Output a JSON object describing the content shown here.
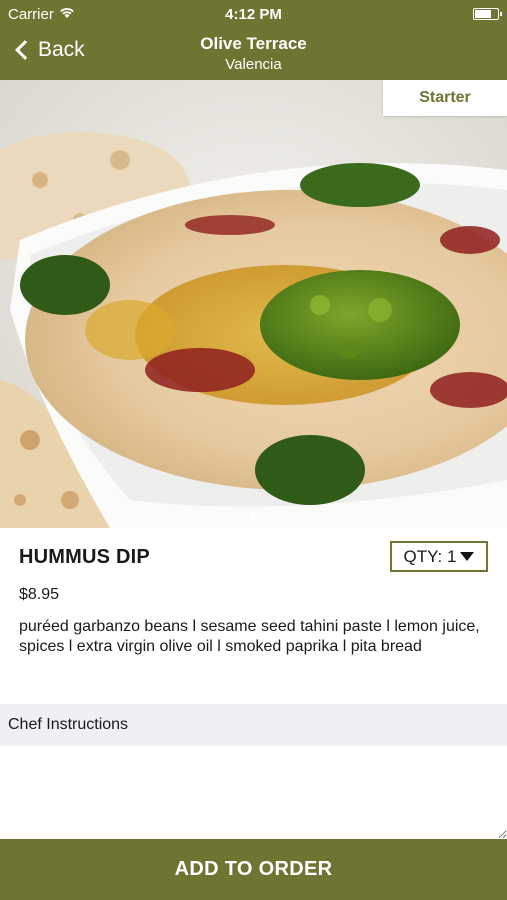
{
  "status_bar": {
    "carrier": "Carrier",
    "time": "4:12 PM",
    "wifi_icon": "wifi-icon",
    "battery_icon": "battery-icon"
  },
  "nav": {
    "back_label": "Back",
    "title": "Olive Terrace",
    "subtitle": "Valencia",
    "back_icon": "chevron-left-icon"
  },
  "hero": {
    "category": "Starter",
    "image_subject": "hummus-dish-photo"
  },
  "item": {
    "name": "HUMMUS DIP",
    "price": "$8.95",
    "description": "puréed garbanzo beans l sesame seed tahini paste l lemon juice, spices l extra virgin olive oil l smoked paprika l pita bread",
    "qty_label": "QTY: 1",
    "qty_icon": "dropdown-triangle-icon"
  },
  "chef_instructions": {
    "label": "Chef Instructions",
    "value": ""
  },
  "footer": {
    "add_label": "ADD TO ORDER"
  },
  "colors": {
    "brand": "#6f7432",
    "section_bg": "#efeff4"
  }
}
